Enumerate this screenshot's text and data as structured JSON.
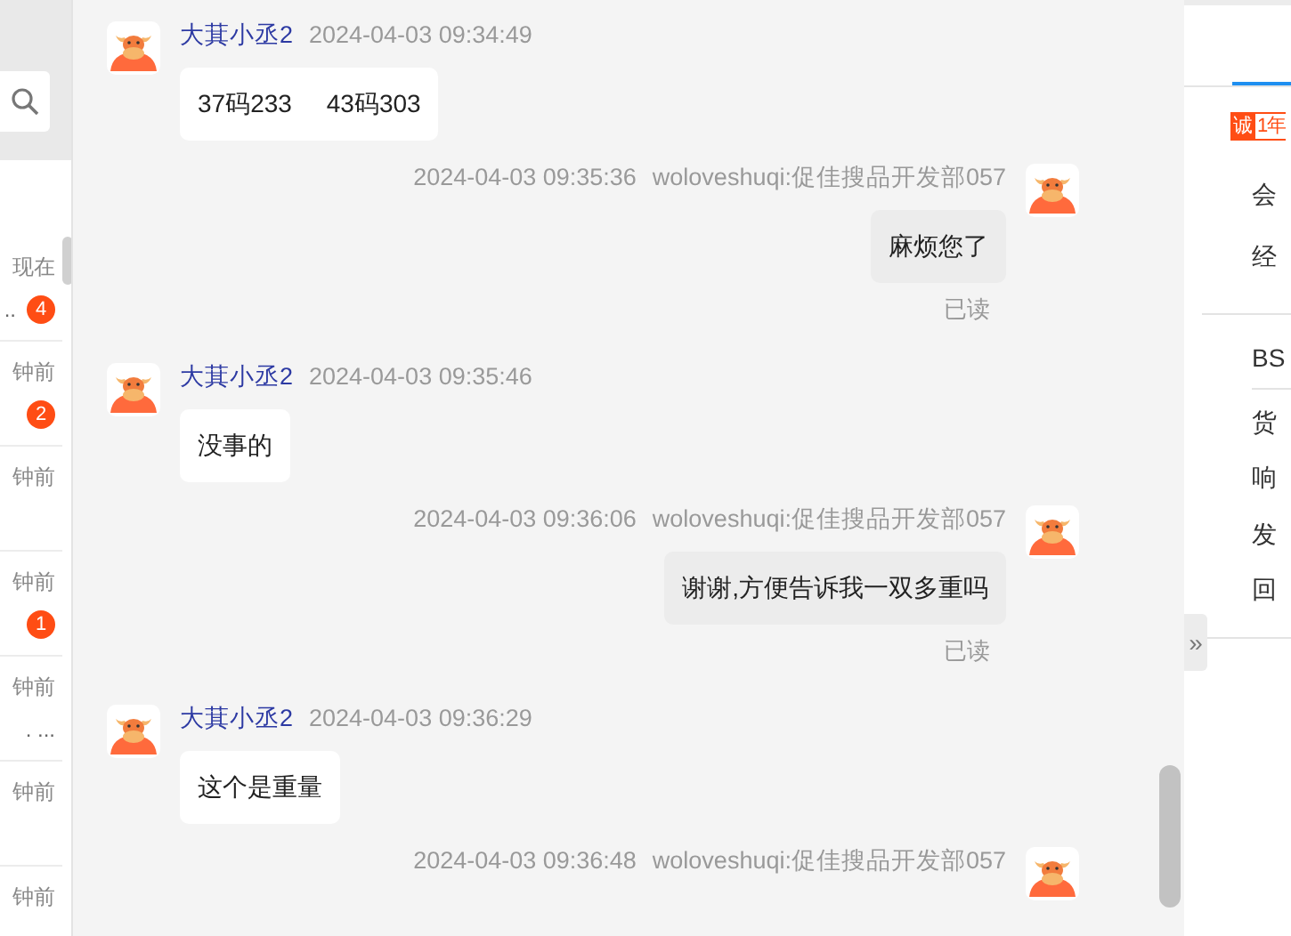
{
  "conversation_list": {
    "items": [
      {
        "time": "现在",
        "preview": "..",
        "unread": "4"
      },
      {
        "time": "钟前",
        "unread": "2"
      },
      {
        "time": "钟前"
      },
      {
        "time": "钟前",
        "unread": "1"
      },
      {
        "time": "钟前",
        "preview": ". ..."
      },
      {
        "time": "钟前"
      },
      {
        "time": "钟前"
      }
    ]
  },
  "messages": [
    {
      "kind": "incoming",
      "sender": "大萁小丞2",
      "time": "2024-04-03 09:34:49",
      "text": "37码233     43码303"
    },
    {
      "kind": "outgoing",
      "sender": "woloveshuqi:促佳搜品开发部057",
      "time": "2024-04-03 09:35:36",
      "text": "麻烦您了",
      "status": "已读"
    },
    {
      "kind": "incoming",
      "sender": "大萁小丞2",
      "time": "2024-04-03 09:35:46",
      "text": "没事的"
    },
    {
      "kind": "outgoing",
      "sender": "woloveshuqi:促佳搜品开发部057",
      "time": "2024-04-03 09:36:06",
      "text": "谢谢,方便告诉我一双多重吗",
      "status": "已读"
    },
    {
      "kind": "incoming",
      "sender": "大萁小丞2",
      "time": "2024-04-03 09:36:29",
      "text": "这个是重量"
    },
    {
      "kind": "outgoing",
      "sender": "woloveshuqi:促佳搜品开发部057",
      "time": "2024-04-03 09:36:48"
    }
  ],
  "side_panel": {
    "badge": {
      "mark": "诚",
      "years": "1年"
    },
    "group_1": [
      "会",
      "经"
    ],
    "group_2": [
      "BS",
      "货",
      "响",
      "发",
      "回"
    ],
    "collapse_button": "»"
  }
}
